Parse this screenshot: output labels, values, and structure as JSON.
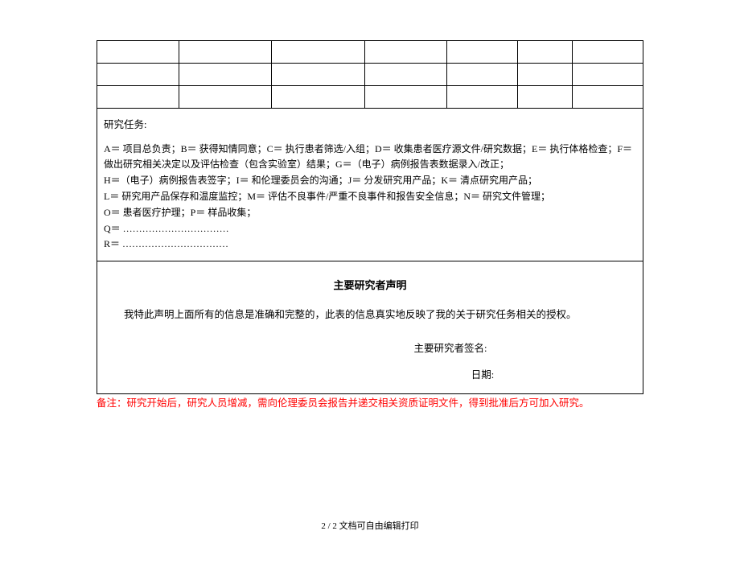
{
  "tasks": {
    "title": "研究任务:",
    "body_line1": "A＝ 项目总负责；B＝ 获得知情同意；C＝ 执行患者筛选/入组；D＝ 收集患者医疗源文件/研究数据；E＝ 执行体格检查；F＝ 做出研究相关决定以及评估检查（包含实验室）结果；G＝（电子）病例报告表数据录入/改正；",
    "body_line2": "H＝（电子）病例报告表签字；I＝ 和伦理委员会的沟通；J＝ 分发研究用产品；K＝ 清点研究用产品；",
    "body_line3": "L＝ 研究用产品保存和温度监控；M＝ 评估不良事件/严重不良事件和报告安全信息；N＝ 研究文件管理；",
    "body_line4": "O＝ 患者医疗护理；P＝ 样品收集；",
    "body_line5": "Q＝ ……………………………",
    "body_line6": "R＝ ……………………………"
  },
  "declaration": {
    "title": "主要研究者声明",
    "text": "我特此声明上面所有的信息是准确和完整的，此表的信息真实地反映了我的关于研究任务相关的授权。",
    "sig_label": "主要研究者签名:",
    "date_label": "日期:"
  },
  "note": {
    "label": "备注：",
    "text": "研究开始后，研究人员增减，需向伦理委员会报告并递交相关资质证明文件，得到批准后方可加入研究。"
  },
  "footer": "2 / 2 文档可自由编辑打印"
}
